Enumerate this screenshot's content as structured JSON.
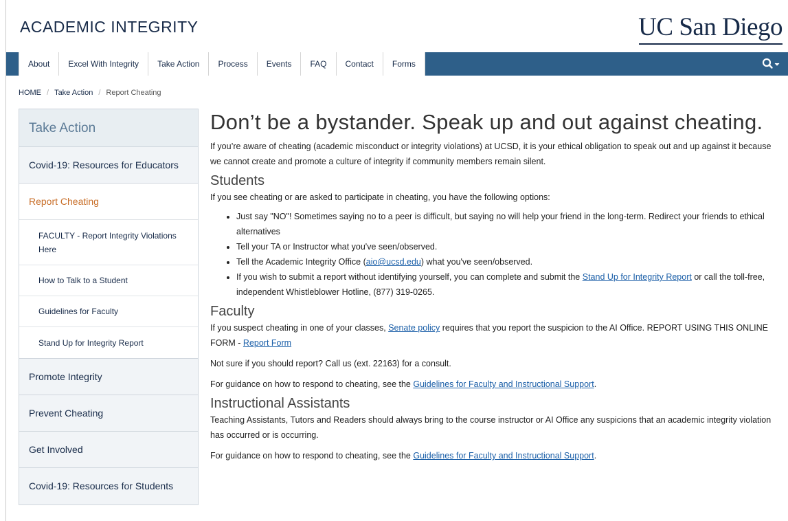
{
  "header": {
    "site_title": "ACADEMIC INTEGRITY",
    "logo_text": "UC San Diego"
  },
  "nav": {
    "items": [
      "About",
      "Excel With Integrity",
      "Take Action",
      "Process",
      "Events",
      "FAQ",
      "Contact",
      "Forms"
    ],
    "search_icon": "search-icon"
  },
  "breadcrumb": {
    "home": "HOME",
    "sep": "/",
    "level1": "Take Action",
    "current": "Report Cheating"
  },
  "sidenav": {
    "heading": "Take Action",
    "items": [
      "Covid-19: Resources for Educators",
      "Report Cheating",
      "Promote Integrity",
      "Prevent Cheating",
      "Get Involved",
      "Covid-19: Resources for Students"
    ],
    "sub_items": [
      "FACULTY - Report Integrity Violations Here",
      "How to Talk to a Student",
      "Guidelines for Faculty",
      "Stand Up for Integrity Report"
    ]
  },
  "content": {
    "title": "Don’t be a bystander. Speak up and out against cheating.",
    "intro": "If you’re aware of cheating (academic misconduct or integrity violations) at UCSD, it is your ethical obligation to speak out and up against it because we cannot create and promote a culture of integrity if community members remain silent.",
    "students": {
      "heading": "Students",
      "lead": "If you see cheating or are asked to participate in cheating, you have the following options:",
      "b1": "Just say \"NO\"! Sometimes saying no to a peer is difficult, but saying no will help your friend in the long-term. Redirect your friends to ethical alternatives",
      "b2": "Tell your TA or Instructor what you've seen/observed.",
      "b3_pre": "Tell the Academic Integrity Office (",
      "b3_link": "aio@ucsd.edu",
      "b3_post": ") what you've seen/observed.",
      "b4_pre": "If you wish to submit a report without identifying yourself, you can complete and submit the ",
      "b4_link": "Stand Up for Integrity Report",
      "b4_post": " or call the toll-free, independent Whistleblower Hotline, (877) 319-0265."
    },
    "faculty": {
      "heading": "Faculty",
      "p1_pre": "If you suspect cheating in one of your classes, ",
      "p1_link": "Senate policy",
      "p1_mid": " requires that you report the suspicion to the AI Office. REPORT USING THIS ONLINE FORM - ",
      "p1_link2": "Report Form",
      "p2": "Not sure if you should report? Call us (ext. 22163) for a consult.",
      "p3_pre": "For guidance on how to respond to cheating, see the ",
      "p3_link": "Guidelines for Faculty and Instructional Support",
      "p3_post": "."
    },
    "ia": {
      "heading": "Instructional Assistants",
      "p1": "Teaching Assistants, Tutors and Readers should always bring to the course instructor or AI Office any suspicions that an academic integrity violation has occurred or is occurring.",
      "p2_pre": "For guidance on how to respond to cheating, see the ",
      "p2_link": "Guidelines for Faculty and Instructional Support",
      "p2_post": "."
    }
  }
}
